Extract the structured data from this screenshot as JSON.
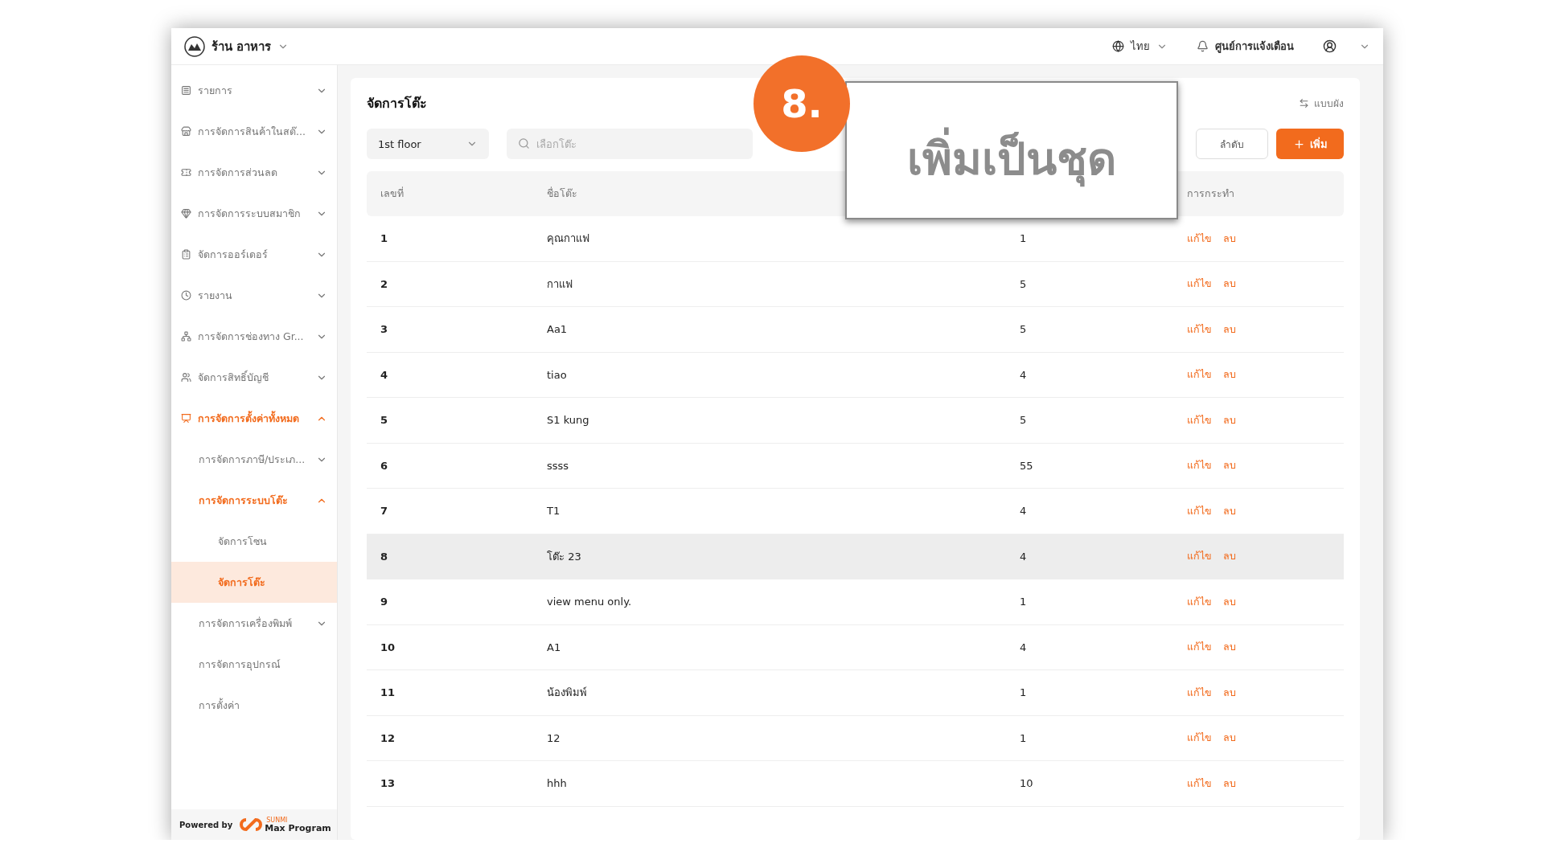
{
  "header": {
    "store": "ร้าน อาหาร",
    "language": "ไทย",
    "notifications": "ศูนย์การแจ้งเตือน"
  },
  "sidebar": {
    "items": [
      {
        "label": "รายการ",
        "expanded": false,
        "selected": false
      },
      {
        "label": "การจัดการสินค้าในสต๊...",
        "expanded": false,
        "selected": false
      },
      {
        "label": "การจัดการส่วนลด",
        "expanded": false,
        "selected": false
      },
      {
        "label": "การจัดการระบบสมาชิก",
        "expanded": false,
        "selected": false
      },
      {
        "label": "จัดการออร์เดอร์",
        "expanded": false,
        "selected": false
      },
      {
        "label": "รายงาน",
        "expanded": false,
        "selected": false
      },
      {
        "label": "การจัดการช่องทาง Gr...",
        "expanded": false,
        "selected": false
      },
      {
        "label": "จัดการสิทธิ์บัญชี",
        "expanded": false,
        "selected": false
      },
      {
        "label": "การจัดการตั้งค่าทั้งหมด",
        "expanded": true,
        "selected": false,
        "children": [
          {
            "label": "การจัดการภาษี/ประเภ...",
            "expanded": false,
            "selected": false
          },
          {
            "label": "การจัดการระบบโต๊ะ",
            "expanded": true,
            "selected": false,
            "children": [
              {
                "label": "จัดการโซน",
                "selected": false
              },
              {
                "label": "จัดการโต๊ะ",
                "selected": true
              }
            ]
          },
          {
            "label": "การจัดการเครื่องพิมพ์",
            "expanded": false,
            "selected": false
          },
          {
            "label": "การจัดการอุปกรณ์",
            "selected": false
          },
          {
            "label": "การตั้งค่า",
            "selected": false
          }
        ]
      }
    ],
    "footer": {
      "powered_by": "Powered by",
      "brand_small": "SUNMI",
      "brand": "Max Program"
    }
  },
  "page": {
    "title": "จัดการโต๊ะ",
    "view_toggle": "แบบผัง",
    "floor_select": "1st floor",
    "search": {
      "placeholder": "เลือกโต๊ะ"
    },
    "sort_button": "ลำดับ",
    "add_button": "เพิ่ม"
  },
  "table": {
    "columns": [
      "เลขที่",
      "ชื่อโต๊ะ",
      "การกระทำ"
    ],
    "rows": [
      {
        "number": "1",
        "name": "คุณกาแฟ",
        "column_3": "1",
        "edit": "แก้ไข",
        "delete": "ลบ",
        "highlighted": false
      },
      {
        "number": "2",
        "name": "กาแฟ",
        "column_3": "5",
        "edit": "แก้ไข",
        "delete": "ลบ",
        "highlighted": false
      },
      {
        "number": "3",
        "name": "Aa1",
        "column_3": "5",
        "edit": "แก้ไข",
        "delete": "ลบ",
        "highlighted": false
      },
      {
        "number": "4",
        "name": "tiao",
        "column_3": "4",
        "edit": "แก้ไข",
        "delete": "ลบ",
        "highlighted": false
      },
      {
        "number": "5",
        "name": "S1 kung",
        "column_3": "5",
        "edit": "แก้ไข",
        "delete": "ลบ",
        "highlighted": false
      },
      {
        "number": "6",
        "name": "ssss",
        "column_3": "55",
        "edit": "แก้ไข",
        "delete": "ลบ",
        "highlighted": false
      },
      {
        "number": "7",
        "name": "T1",
        "column_3": "4",
        "edit": "แก้ไข",
        "delete": "ลบ",
        "highlighted": false
      },
      {
        "number": "8",
        "name": "โต๊ะ 23",
        "column_3": "4",
        "edit": "แก้ไข",
        "delete": "ลบ",
        "highlighted": true
      },
      {
        "number": "9",
        "name": "view menu only.",
        "column_3": "1",
        "edit": "แก้ไข",
        "delete": "ลบ",
        "highlighted": false
      },
      {
        "number": "10",
        "name": "A1",
        "column_3": "4",
        "edit": "แก้ไข",
        "delete": "ลบ",
        "highlighted": false
      },
      {
        "number": "11",
        "name": "น้องพิมพ์",
        "column_3": "1",
        "edit": "แก้ไข",
        "delete": "ลบ",
        "highlighted": false
      },
      {
        "number": "12",
        "name": "12",
        "column_3": "1",
        "edit": "แก้ไข",
        "delete": "ลบ",
        "highlighted": false
      },
      {
        "number": "13",
        "name": "hhh",
        "column_3": "10",
        "edit": "แก้ไข",
        "delete": "ลบ",
        "highlighted": false
      }
    ]
  },
  "callout": {
    "number": "8.",
    "text": "เพิ่มเป็นชุด"
  }
}
